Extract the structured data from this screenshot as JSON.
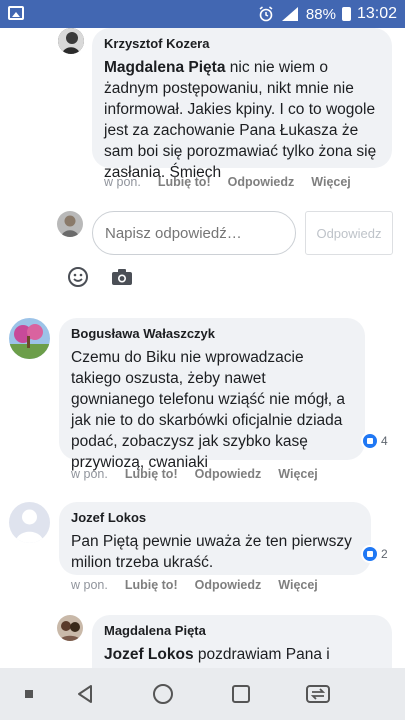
{
  "status_bar": {
    "battery": "88%",
    "time": "13:02",
    "network": "LTE"
  },
  "comments": [
    {
      "author": "Krzysztof Kozera",
      "mention": "Magdalena Pięta",
      "text": " nic nie wiem o żadnym postępowaniu, nikt mnie nie informował. Jakies kpiny. I co to wogole jest za zachowanie Pana Łukasza że sam boi się porozmawiać tylko żona się zasłania. Śmiech",
      "time": "w pon.",
      "like_label": "Lubię to!",
      "reply_label": "Odpowiedz",
      "more_label": "Więcej"
    },
    {
      "author": "Bogusława Wałaszczyk",
      "text": "Czemu do Biku nie wprowadzacie takiego oszusta, żeby nawet gownianego telefonu wziąść nie mógł, a jak nie to do skarbówki oficjalnie dziada podać, zobaczysz jak szybko kasę przywiozą, cwaniaki",
      "time": "w pon.",
      "like_label": "Lubię to!",
      "reply_label": "Odpowiedz",
      "more_label": "Więcej",
      "reactions": "4"
    },
    {
      "author": "Jozef Lokos",
      "text": "Pan Piętą pewnie uważa że ten pierwszy milion trzeba ukraść.",
      "time": "w pon.",
      "like_label": "Lubię to!",
      "reply_label": "Odpowiedz",
      "more_label": "Więcej",
      "reactions": "2"
    },
    {
      "author": "Magdalena Pięta",
      "mention": "Jozef Lokos",
      "text": " pozdrawiam Pana i zapewniam że mój mąż nie z takich"
    }
  ],
  "reply_box": {
    "placeholder": "Napisz odpowiedź…",
    "button_label": "Odpowiedz"
  },
  "colors": {
    "status_bar": "#4267b2",
    "bubble": "#f0f2f5",
    "like_blue": "#2078f4"
  }
}
